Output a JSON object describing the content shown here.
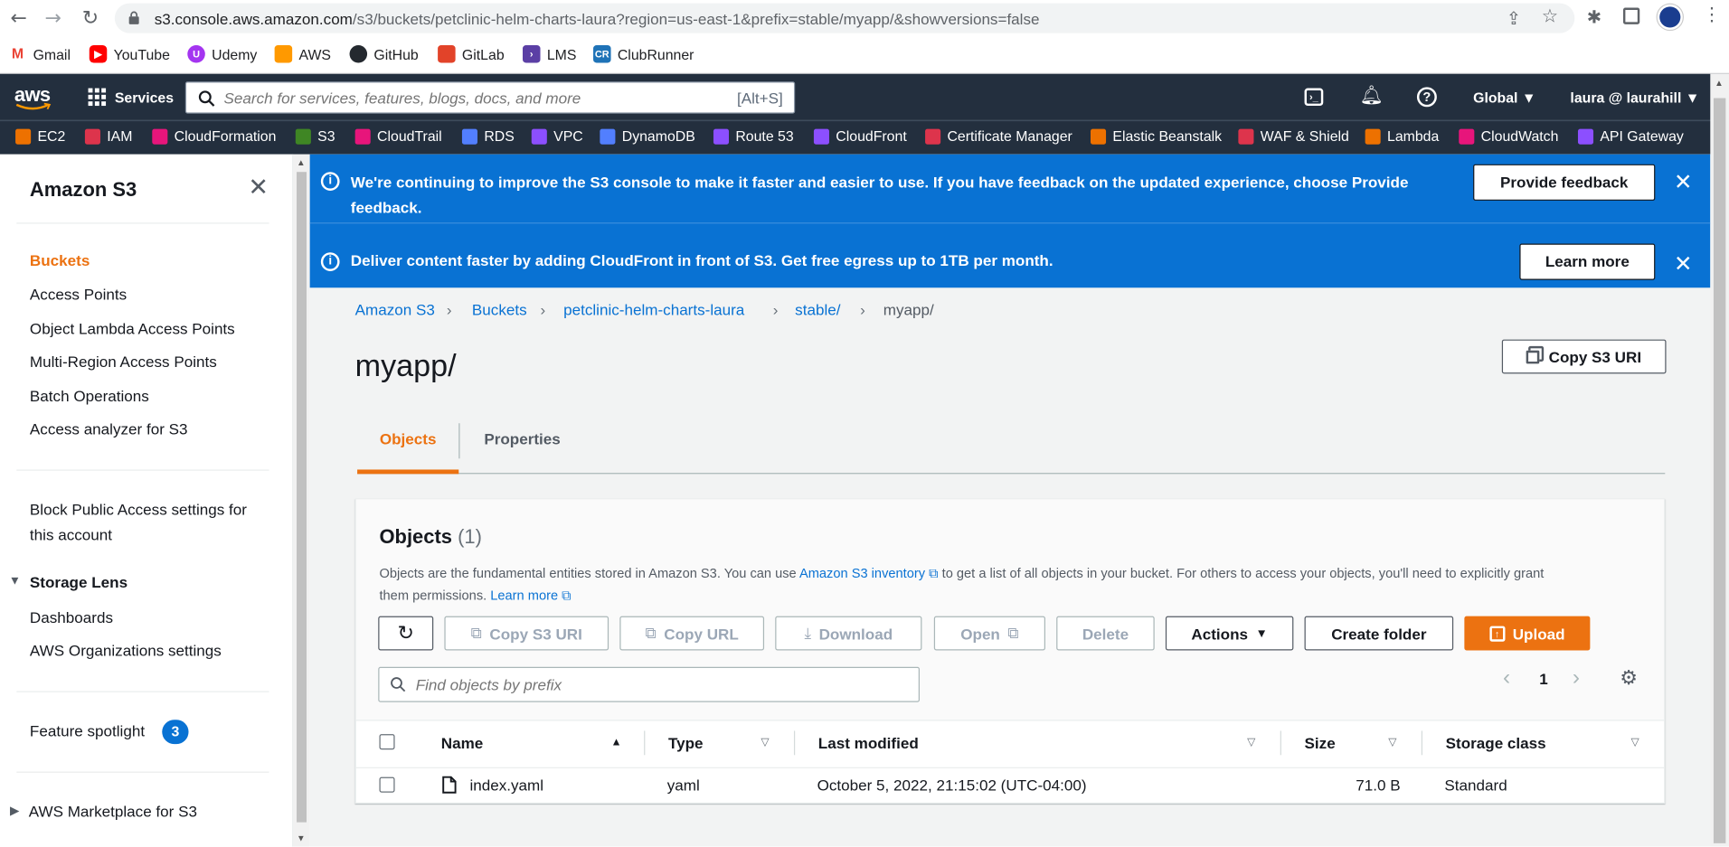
{
  "browser": {
    "url_host": "s3.console.aws.amazon.com",
    "url_path": "/s3/buckets/petclinic-helm-charts-laura?region=us-east-1&prefix=stable/myapp/&showversions=false",
    "bookmarks": [
      "Gmail",
      "YouTube",
      "Udemy",
      "AWS",
      "GitHub",
      "GitLab",
      "LMS",
      "ClubRunner"
    ]
  },
  "aws_header": {
    "services_label": "Services",
    "search_placeholder": "Search for services, features, blogs, docs, and more",
    "search_shortcut": "[Alt+S]",
    "region": "Global",
    "account": "laura @ laurahill",
    "service_shortcuts": [
      "EC2",
      "IAM",
      "CloudFormation",
      "S3",
      "CloudTrail",
      "RDS",
      "VPC",
      "DynamoDB",
      "Route 53",
      "CloudFront",
      "Certificate Manager",
      "Elastic Beanstalk",
      "WAF & Shield",
      "Lambda",
      "CloudWatch",
      "API Gateway"
    ]
  },
  "sidebar": {
    "title": "Amazon S3",
    "items": [
      "Buckets",
      "Access Points",
      "Object Lambda Access Points",
      "Multi-Region Access Points",
      "Batch Operations",
      "Access analyzer for S3"
    ],
    "block_public_line1": "Block Public Access settings for",
    "block_public_line2": "this account",
    "storage_lens": "Storage Lens",
    "storage_lens_items": [
      "Dashboards",
      "AWS Organizations settings"
    ],
    "feature_spotlight": "Feature spotlight",
    "feature_spotlight_count": "3",
    "marketplace": "AWS Marketplace for S3"
  },
  "flash": {
    "msg1_a": "We're continuing to improve the S3 console to make it faster and easier to use. If you have feedback on the updated experience, choose ",
    "msg1_b": "Provide",
    "msg1_c": "feedback",
    "msg1_end": ".",
    "btn1": "Provide feedback",
    "msg2": "Deliver content faster by adding CloudFront in front of S3. Get free egress up to 1TB per month.",
    "btn2": "Learn more"
  },
  "breadcrumb": [
    "Amazon S3",
    "Buckets",
    "petclinic-helm-charts-laura",
    "stable/",
    "myapp/"
  ],
  "page": {
    "title": "myapp/",
    "copy_uri": "Copy S3 URI",
    "tabs": [
      "Objects",
      "Properties"
    ]
  },
  "objects": {
    "heading": "Objects",
    "count": "(1)",
    "desc_a": "Objects are the fundamental entities stored in Amazon S3. You can use ",
    "desc_link": "Amazon S3 inventory",
    "desc_b": " to get a list of all objects in your bucket. For others to access your objects, you'll need to explicitly grant",
    "desc_c": "them permissions. ",
    "desc_learn": "Learn more",
    "buttons": {
      "copy_uri": "Copy S3 URI",
      "copy_url": "Copy URL",
      "download": "Download",
      "open": "Open",
      "delete": "Delete",
      "actions": "Actions",
      "create_folder": "Create folder",
      "upload": "Upload"
    },
    "filter_placeholder": "Find objects by prefix",
    "page_number": "1",
    "columns": [
      "Name",
      "Type",
      "Last modified",
      "Size",
      "Storage class"
    ],
    "rows": [
      {
        "name": "index.yaml",
        "type": "yaml",
        "modified": "October 5, 2022, 21:15:02 (UTC-04:00)",
        "size": "71.0 B",
        "storage": "Standard"
      }
    ]
  },
  "colors": {
    "accent": "#ec7211",
    "link": "#0972d3",
    "flash": "#0972d3",
    "nav": "#232f3e"
  }
}
